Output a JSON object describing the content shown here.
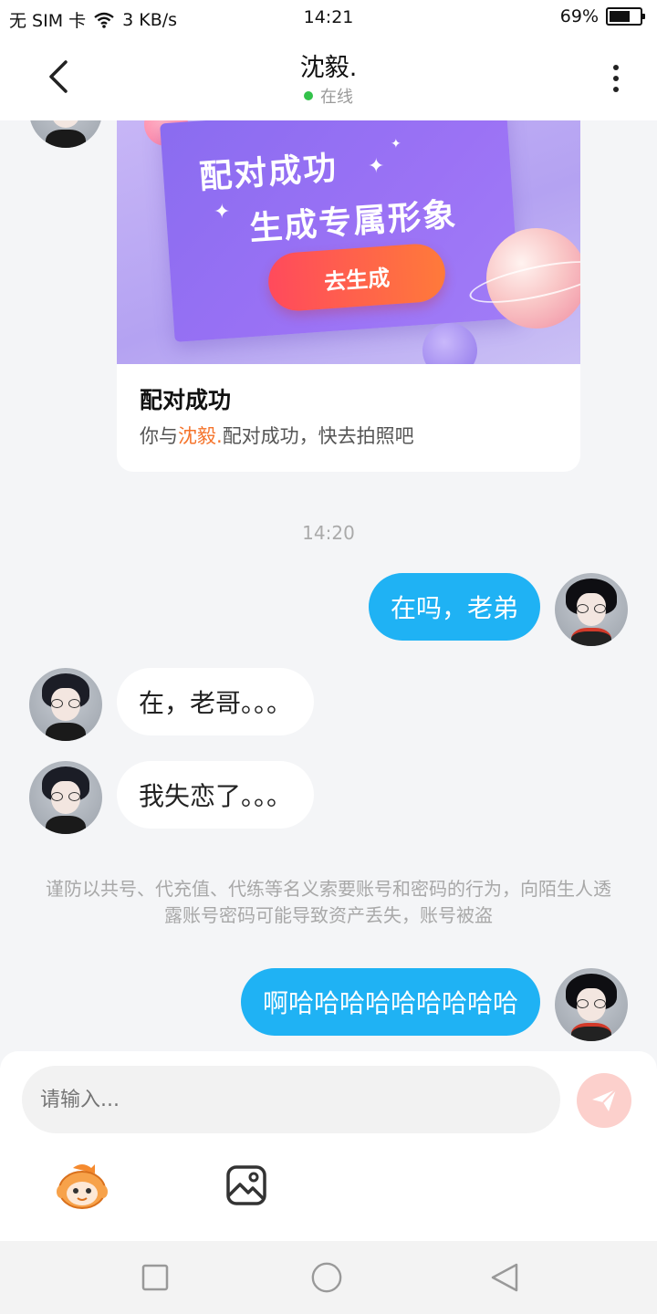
{
  "status_bar": {
    "carrier": "无 SIM 卡",
    "network_speed": "3 KB/s",
    "time": "14:21",
    "battery_percent": "69%",
    "battery_level": 0.69
  },
  "header": {
    "title": "沈毅.",
    "presence": "在线",
    "presence_color": "#33c24a"
  },
  "match_card": {
    "banner_line1": "配对成功",
    "banner_line2": "生成专属形象",
    "banner_button": "去生成",
    "title": "配对成功",
    "desc_prefix": "你与",
    "desc_name": "沈毅.",
    "desc_suffix": "配对成功，快去拍照吧"
  },
  "messages": {
    "timestamp": "14:20",
    "m1": "在吗，老弟",
    "m2": "在，老哥。。。",
    "m3": "我失恋了。。。",
    "m4": "啊哈哈哈哈哈哈哈哈哈"
  },
  "notice": "谨防以共号、代充值、代练等名义索要账号和密码的行为，向陌生人透露账号密码可能导致资产丢失，账号被盗",
  "input": {
    "placeholder": "请输入..."
  },
  "colors": {
    "outgoing_bubble": "#1fb2f4",
    "accent_name": "#f5732a",
    "send_button": "#fcd0cc"
  },
  "icons": [
    "back-arrow-icon",
    "more-vertical-icon",
    "send-icon",
    "emoji-icon",
    "image-icon",
    "nav-recent-icon",
    "nav-home-icon",
    "nav-back-icon"
  ]
}
